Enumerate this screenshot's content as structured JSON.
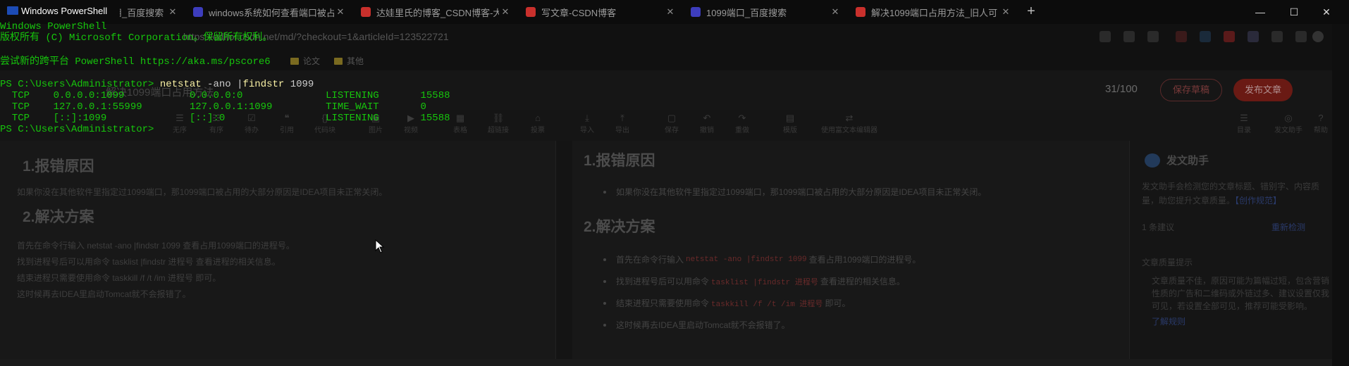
{
  "browser": {
    "tabs": [
      {
        "title": "用_百度搜索",
        "favicon": "baidu-icon"
      },
      {
        "title": "windows系统如何查看端口被占",
        "favicon": "baidu-icon"
      },
      {
        "title": "达娃里氏的博客_CSDN博客-大乘",
        "favicon": "csdn-icon"
      },
      {
        "title": "写文章-CSDN博客",
        "favicon": "csdn-icon"
      },
      {
        "title": "1099端口_百度搜索",
        "favicon": "baidu-icon"
      },
      {
        "title": "解决1099端口占用方法_旧人可",
        "favicon": "csdn-icon"
      }
    ],
    "new_tab": "+",
    "window_controls": {
      "minimize": "—",
      "maximize": "☐",
      "close": "✕"
    },
    "url": "https://editor.csdn.net/md/?checkout=1&articleId=123522721",
    "bookmarks": [
      "论文",
      "其他"
    ],
    "editor": {
      "doc_title": "解决1099端口占用方法",
      "word_count": "31/100",
      "save_draft": "保存草稿",
      "publish": "发布文章",
      "toolbar": [
        "无序",
        "有序",
        "待办",
        "引用",
        "代码块",
        "图片",
        "视频",
        "表格",
        "超链接",
        "投票",
        "导入",
        "导出",
        "保存",
        "撤销",
        "重做",
        "模版",
        "使用富文本编辑器",
        "目录",
        "发文助手",
        "帮助"
      ],
      "left": {
        "h1": "1.报错原因",
        "p1": "如果你没在其他软件里指定过1099端口，那1099端口被占用的大部分原因是IDEA项目未正常关闭。",
        "h2": "2.解决方案",
        "p2": "首先在命令行输入 netstat -ano |findstr 1099 查看占用1099端口的进程号。",
        "p3": "找到进程号后可以用命令 tasklist |findstr 进程号 查看进程的相关信息。",
        "p4": "结束进程只需要使用命令 taskkill /f /t /im 进程号 即可。",
        "p5": "这时候再去IDEA里启动Tomcat就不会报错了。"
      },
      "preview": {
        "h1": "1.报错原因",
        "li1": "如果你没在其他软件里指定过1099端口，那1099端口被占用的大部分原因是IDEA项目未正常关闭。",
        "h2": "2.解决方案",
        "li2_pre": "首先在命令行输入",
        "li2_code": "netstat -ano |findstr 1099",
        "li2_post": "查看占用1099端口的进程号。",
        "li3_pre": "找到进程号后可以用命令",
        "li3_code": "tasklist |findstr 进程号",
        "li3_post": "查看进程的相关信息。",
        "li4_pre": "结束进程只需要使用命令",
        "li4_code": "taskkill /f /t /im 进程号",
        "li4_post": "即可。",
        "li5": "这时候再去IDEA里启动Tomcat就不会报错了。"
      },
      "assistant": {
        "title": "发文助手",
        "desc1": "发文助手会检测您的文章标题、错别字、内容质",
        "desc2": "量，助您提升文章质量。",
        "desc_link": "【创作规范】",
        "suggest": "1 条建议",
        "refresh": "重新检测",
        "quality_title": "文章质量提示",
        "q1": "文章质量不佳，原因可能为篇幅过短，包含营销",
        "q2": "性质的广告和二维码或外链过多、建议设置仅我",
        "q3": "可见，若设置全部可见，推荐可能受影响。",
        "q4_link": "了解规则"
      }
    }
  },
  "powershell": {
    "title": "Windows PowerShell",
    "lines": [
      "Windows PowerShell",
      "版权所有 (C) Microsoft Corporation。保留所有权利。",
      "",
      "尝试新的跨平台 PowerShell https://aka.ms/pscore6",
      ""
    ],
    "prompt": "PS C:\\Users\\Administrator> ",
    "cmd_name": "netstat",
    "cmd_arg1": " -ano ",
    "cmd_pipe": "|",
    "cmd_name2": "findstr",
    "cmd_arg2": " 1099",
    "rows": [
      "  TCP    0.0.0.0:1099           0.0.0.0:0              LISTENING       15588",
      "  TCP    127.0.0.1:55999        127.0.0.1:1099         TIME_WAIT       0",
      "  TCP    [::]:1099              [::]:0                 LISTENING       15588"
    ],
    "final_prompt": "PS C:\\Users\\Administrator>"
  }
}
